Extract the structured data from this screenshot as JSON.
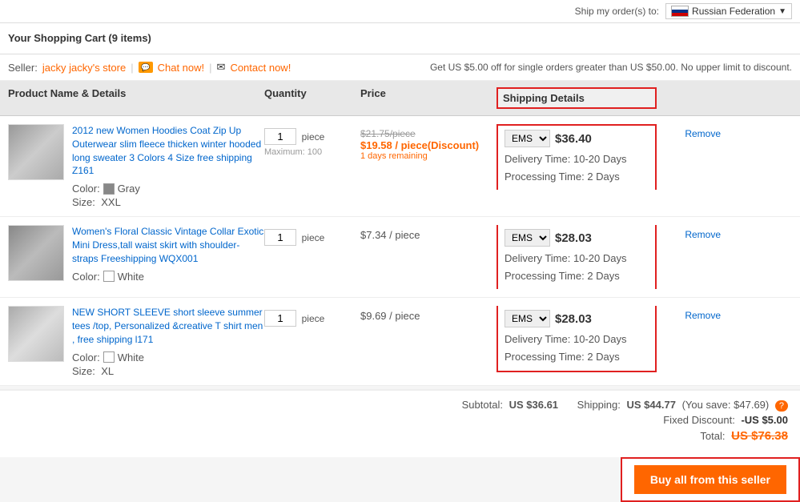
{
  "topbar": {
    "ship_label": "Ship my order(s) to:",
    "country": "Russian Federation"
  },
  "header": {
    "title": "Your Shopping Cart (9 items)"
  },
  "seller": {
    "label": "Seller:",
    "name": "jacky jacky's store",
    "chat_label": "Chat now!",
    "contact_label": "Contact now!",
    "discount_notice": "Get US $5.00 off for single orders greater than US $50.00. No upper limit to discount."
  },
  "table": {
    "col_product": "Product Name & Details",
    "col_quantity": "Quantity",
    "col_price": "Price",
    "col_shipping": "Shipping Details"
  },
  "products": [
    {
      "id": 1,
      "title": "2012 new Women Hoodies Coat Zip Up Outerwear slim fleece thicken winter hooded long sweater 3 Colors 4 Size free shipping Z161",
      "color_label": "Color:",
      "color_name": "Gray",
      "color_type": "gray",
      "size_label": "Size:",
      "size_value": "XXL",
      "qty": "1",
      "qty_unit": "piece",
      "qty_max": "Maximum: 100",
      "original_price": "$21.75/piece",
      "discount_price": "$19.58 / piece(Discount)",
      "remaining": "1 days remaining",
      "shipping_method": "EMS",
      "shipping_price": "$36.40",
      "delivery_time": "10-20 Days",
      "processing_time": "2 Days",
      "remove_label": "Remove"
    },
    {
      "id": 2,
      "title": "Women's Floral Classic Vintage Collar Exotic Mini Dress,tall waist skirt with shoulder-straps Freeshipping WQX001",
      "color_label": "Color:",
      "color_name": "White",
      "color_type": "white",
      "qty": "1",
      "qty_unit": "piece",
      "regular_price": "$7.34 / piece",
      "shipping_method": "EMS",
      "shipping_price": "$28.03",
      "delivery_time": "10-20 Days",
      "processing_time": "2 Days",
      "remove_label": "Remove"
    },
    {
      "id": 3,
      "title": "NEW SHORT SLEEVE short sleeve summer tees /top, Personalized &creative T shirt men , free shipping l171",
      "color_label": "Color:",
      "color_name": "White",
      "color_type": "white2",
      "size_label": "Size:",
      "size_value": "XL",
      "qty": "1",
      "qty_unit": "piece",
      "regular_price": "$9.69 / piece",
      "shipping_method": "EMS",
      "shipping_price": "$28.03",
      "delivery_time": "10-20 Days",
      "processing_time": "2 Days",
      "remove_label": "Remove"
    }
  ],
  "summary": {
    "subtotal_label": "Subtotal:",
    "subtotal_value": "US $36.61",
    "shipping_label": "Shipping:",
    "shipping_value": "US $44.77",
    "you_save_label": "You save: $47.69",
    "fixed_discount_label": "Fixed Discount:",
    "fixed_discount_value": "-US $5.00",
    "total_label": "Total:",
    "total_value": "US $76.38"
  },
  "buy_button": "Buy all from this seller"
}
